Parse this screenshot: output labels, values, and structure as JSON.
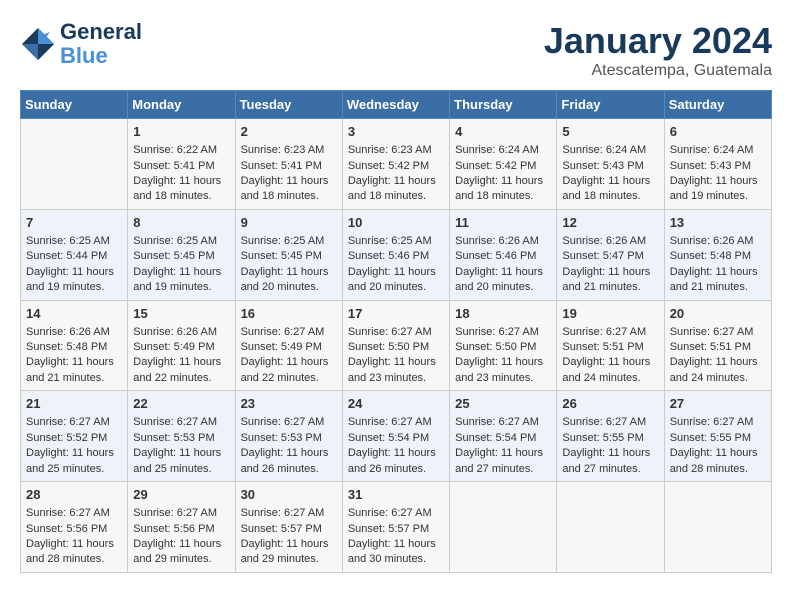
{
  "header": {
    "logo_line1": "General",
    "logo_line2": "Blue",
    "title": "January 2024",
    "subtitle": "Atescatempa, Guatemala"
  },
  "weekdays": [
    "Sunday",
    "Monday",
    "Tuesday",
    "Wednesday",
    "Thursday",
    "Friday",
    "Saturday"
  ],
  "weeks": [
    [
      {
        "day": "",
        "info": ""
      },
      {
        "day": "1",
        "info": "Sunrise: 6:22 AM\nSunset: 5:41 PM\nDaylight: 11 hours and 18 minutes."
      },
      {
        "day": "2",
        "info": "Sunrise: 6:23 AM\nSunset: 5:41 PM\nDaylight: 11 hours and 18 minutes."
      },
      {
        "day": "3",
        "info": "Sunrise: 6:23 AM\nSunset: 5:42 PM\nDaylight: 11 hours and 18 minutes."
      },
      {
        "day": "4",
        "info": "Sunrise: 6:24 AM\nSunset: 5:42 PM\nDaylight: 11 hours and 18 minutes."
      },
      {
        "day": "5",
        "info": "Sunrise: 6:24 AM\nSunset: 5:43 PM\nDaylight: 11 hours and 18 minutes."
      },
      {
        "day": "6",
        "info": "Sunrise: 6:24 AM\nSunset: 5:43 PM\nDaylight: 11 hours and 19 minutes."
      }
    ],
    [
      {
        "day": "7",
        "info": "Sunrise: 6:25 AM\nSunset: 5:44 PM\nDaylight: 11 hours and 19 minutes."
      },
      {
        "day": "8",
        "info": "Sunrise: 6:25 AM\nSunset: 5:45 PM\nDaylight: 11 hours and 19 minutes."
      },
      {
        "day": "9",
        "info": "Sunrise: 6:25 AM\nSunset: 5:45 PM\nDaylight: 11 hours and 20 minutes."
      },
      {
        "day": "10",
        "info": "Sunrise: 6:25 AM\nSunset: 5:46 PM\nDaylight: 11 hours and 20 minutes."
      },
      {
        "day": "11",
        "info": "Sunrise: 6:26 AM\nSunset: 5:46 PM\nDaylight: 11 hours and 20 minutes."
      },
      {
        "day": "12",
        "info": "Sunrise: 6:26 AM\nSunset: 5:47 PM\nDaylight: 11 hours and 21 minutes."
      },
      {
        "day": "13",
        "info": "Sunrise: 6:26 AM\nSunset: 5:48 PM\nDaylight: 11 hours and 21 minutes."
      }
    ],
    [
      {
        "day": "14",
        "info": "Sunrise: 6:26 AM\nSunset: 5:48 PM\nDaylight: 11 hours and 21 minutes."
      },
      {
        "day": "15",
        "info": "Sunrise: 6:26 AM\nSunset: 5:49 PM\nDaylight: 11 hours and 22 minutes."
      },
      {
        "day": "16",
        "info": "Sunrise: 6:27 AM\nSunset: 5:49 PM\nDaylight: 11 hours and 22 minutes."
      },
      {
        "day": "17",
        "info": "Sunrise: 6:27 AM\nSunset: 5:50 PM\nDaylight: 11 hours and 23 minutes."
      },
      {
        "day": "18",
        "info": "Sunrise: 6:27 AM\nSunset: 5:50 PM\nDaylight: 11 hours and 23 minutes."
      },
      {
        "day": "19",
        "info": "Sunrise: 6:27 AM\nSunset: 5:51 PM\nDaylight: 11 hours and 24 minutes."
      },
      {
        "day": "20",
        "info": "Sunrise: 6:27 AM\nSunset: 5:51 PM\nDaylight: 11 hours and 24 minutes."
      }
    ],
    [
      {
        "day": "21",
        "info": "Sunrise: 6:27 AM\nSunset: 5:52 PM\nDaylight: 11 hours and 25 minutes."
      },
      {
        "day": "22",
        "info": "Sunrise: 6:27 AM\nSunset: 5:53 PM\nDaylight: 11 hours and 25 minutes."
      },
      {
        "day": "23",
        "info": "Sunrise: 6:27 AM\nSunset: 5:53 PM\nDaylight: 11 hours and 26 minutes."
      },
      {
        "day": "24",
        "info": "Sunrise: 6:27 AM\nSunset: 5:54 PM\nDaylight: 11 hours and 26 minutes."
      },
      {
        "day": "25",
        "info": "Sunrise: 6:27 AM\nSunset: 5:54 PM\nDaylight: 11 hours and 27 minutes."
      },
      {
        "day": "26",
        "info": "Sunrise: 6:27 AM\nSunset: 5:55 PM\nDaylight: 11 hours and 27 minutes."
      },
      {
        "day": "27",
        "info": "Sunrise: 6:27 AM\nSunset: 5:55 PM\nDaylight: 11 hours and 28 minutes."
      }
    ],
    [
      {
        "day": "28",
        "info": "Sunrise: 6:27 AM\nSunset: 5:56 PM\nDaylight: 11 hours and 28 minutes."
      },
      {
        "day": "29",
        "info": "Sunrise: 6:27 AM\nSunset: 5:56 PM\nDaylight: 11 hours and 29 minutes."
      },
      {
        "day": "30",
        "info": "Sunrise: 6:27 AM\nSunset: 5:57 PM\nDaylight: 11 hours and 29 minutes."
      },
      {
        "day": "31",
        "info": "Sunrise: 6:27 AM\nSunset: 5:57 PM\nDaylight: 11 hours and 30 minutes."
      },
      {
        "day": "",
        "info": ""
      },
      {
        "day": "",
        "info": ""
      },
      {
        "day": "",
        "info": ""
      }
    ]
  ]
}
